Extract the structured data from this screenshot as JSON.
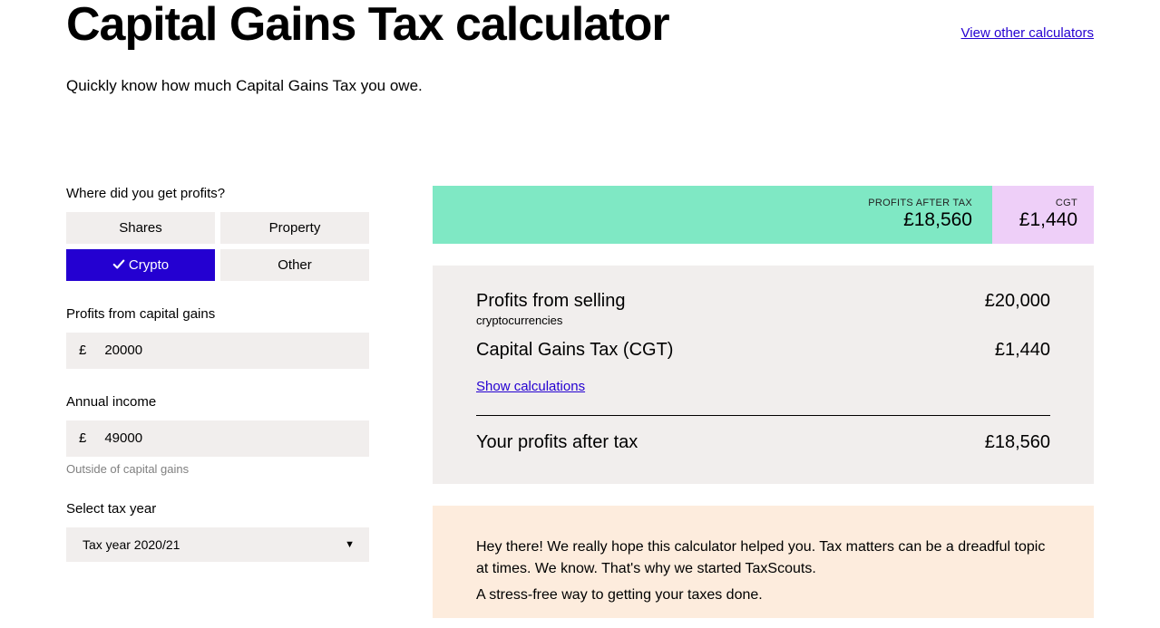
{
  "header": {
    "title": "Capital Gains Tax calculator",
    "view_other": "View other calculators",
    "subtitle": "Quickly know how much Capital Gains Tax you owe."
  },
  "form": {
    "profits_source_label": "Where did you get profits?",
    "source_options": {
      "shares": "Shares",
      "property": "Property",
      "crypto": "Crypto",
      "other": "Other"
    },
    "profits_label": "Profits from capital gains",
    "profits_value": "20000",
    "income_label": "Annual income",
    "income_value": "49000",
    "income_hint": "Outside of capital gains",
    "tax_year_label": "Select tax year",
    "tax_year_selected": "Tax year 2020/21",
    "currency": "£"
  },
  "summary": {
    "profits_label": "PROFITS AFTER TAX",
    "profits_value": "£18,560",
    "cgt_label": "CGT",
    "cgt_value": "£1,440"
  },
  "breakdown": {
    "row1_title": "Profits from selling",
    "row1_sub": "cryptocurrencies",
    "row1_amount": "£20,000",
    "row2_title": "Capital Gains Tax (CGT)",
    "row2_amount": "£1,440",
    "show_calc": "Show calculations",
    "row3_title": "Your profits after tax",
    "row3_amount": "£18,560"
  },
  "promo": {
    "p1": "Hey there! We really hope this calculator helped you. Tax matters can be a dreadful topic at times. We know. That's why we started TaxScouts.",
    "p2": "A stress-free way to getting your taxes done."
  }
}
